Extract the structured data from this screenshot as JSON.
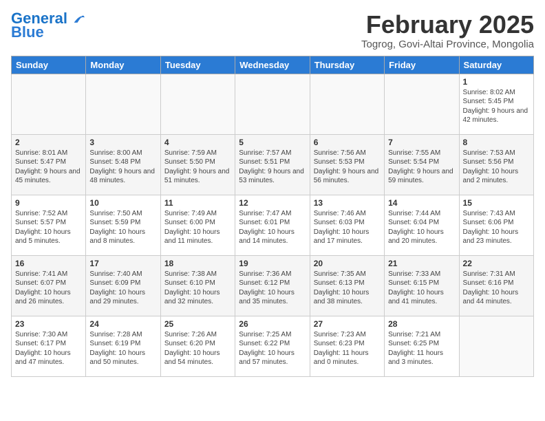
{
  "logo": {
    "line1": "General",
    "line2": "Blue"
  },
  "title": "February 2025",
  "location": "Togrog, Govi-Altai Province, Mongolia",
  "weekdays": [
    "Sunday",
    "Monday",
    "Tuesday",
    "Wednesday",
    "Thursday",
    "Friday",
    "Saturday"
  ],
  "weeks": [
    [
      {
        "day": "",
        "info": ""
      },
      {
        "day": "",
        "info": ""
      },
      {
        "day": "",
        "info": ""
      },
      {
        "day": "",
        "info": ""
      },
      {
        "day": "",
        "info": ""
      },
      {
        "day": "",
        "info": ""
      },
      {
        "day": "1",
        "info": "Sunrise: 8:02 AM\nSunset: 5:45 PM\nDaylight: 9 hours and 42 minutes."
      }
    ],
    [
      {
        "day": "2",
        "info": "Sunrise: 8:01 AM\nSunset: 5:47 PM\nDaylight: 9 hours and 45 minutes."
      },
      {
        "day": "3",
        "info": "Sunrise: 8:00 AM\nSunset: 5:48 PM\nDaylight: 9 hours and 48 minutes."
      },
      {
        "day": "4",
        "info": "Sunrise: 7:59 AM\nSunset: 5:50 PM\nDaylight: 9 hours and 51 minutes."
      },
      {
        "day": "5",
        "info": "Sunrise: 7:57 AM\nSunset: 5:51 PM\nDaylight: 9 hours and 53 minutes."
      },
      {
        "day": "6",
        "info": "Sunrise: 7:56 AM\nSunset: 5:53 PM\nDaylight: 9 hours and 56 minutes."
      },
      {
        "day": "7",
        "info": "Sunrise: 7:55 AM\nSunset: 5:54 PM\nDaylight: 9 hours and 59 minutes."
      },
      {
        "day": "8",
        "info": "Sunrise: 7:53 AM\nSunset: 5:56 PM\nDaylight: 10 hours and 2 minutes."
      }
    ],
    [
      {
        "day": "9",
        "info": "Sunrise: 7:52 AM\nSunset: 5:57 PM\nDaylight: 10 hours and 5 minutes."
      },
      {
        "day": "10",
        "info": "Sunrise: 7:50 AM\nSunset: 5:59 PM\nDaylight: 10 hours and 8 minutes."
      },
      {
        "day": "11",
        "info": "Sunrise: 7:49 AM\nSunset: 6:00 PM\nDaylight: 10 hours and 11 minutes."
      },
      {
        "day": "12",
        "info": "Sunrise: 7:47 AM\nSunset: 6:01 PM\nDaylight: 10 hours and 14 minutes."
      },
      {
        "day": "13",
        "info": "Sunrise: 7:46 AM\nSunset: 6:03 PM\nDaylight: 10 hours and 17 minutes."
      },
      {
        "day": "14",
        "info": "Sunrise: 7:44 AM\nSunset: 6:04 PM\nDaylight: 10 hours and 20 minutes."
      },
      {
        "day": "15",
        "info": "Sunrise: 7:43 AM\nSunset: 6:06 PM\nDaylight: 10 hours and 23 minutes."
      }
    ],
    [
      {
        "day": "16",
        "info": "Sunrise: 7:41 AM\nSunset: 6:07 PM\nDaylight: 10 hours and 26 minutes."
      },
      {
        "day": "17",
        "info": "Sunrise: 7:40 AM\nSunset: 6:09 PM\nDaylight: 10 hours and 29 minutes."
      },
      {
        "day": "18",
        "info": "Sunrise: 7:38 AM\nSunset: 6:10 PM\nDaylight: 10 hours and 32 minutes."
      },
      {
        "day": "19",
        "info": "Sunrise: 7:36 AM\nSunset: 6:12 PM\nDaylight: 10 hours and 35 minutes."
      },
      {
        "day": "20",
        "info": "Sunrise: 7:35 AM\nSunset: 6:13 PM\nDaylight: 10 hours and 38 minutes."
      },
      {
        "day": "21",
        "info": "Sunrise: 7:33 AM\nSunset: 6:15 PM\nDaylight: 10 hours and 41 minutes."
      },
      {
        "day": "22",
        "info": "Sunrise: 7:31 AM\nSunset: 6:16 PM\nDaylight: 10 hours and 44 minutes."
      }
    ],
    [
      {
        "day": "23",
        "info": "Sunrise: 7:30 AM\nSunset: 6:17 PM\nDaylight: 10 hours and 47 minutes."
      },
      {
        "day": "24",
        "info": "Sunrise: 7:28 AM\nSunset: 6:19 PM\nDaylight: 10 hours and 50 minutes."
      },
      {
        "day": "25",
        "info": "Sunrise: 7:26 AM\nSunset: 6:20 PM\nDaylight: 10 hours and 54 minutes."
      },
      {
        "day": "26",
        "info": "Sunrise: 7:25 AM\nSunset: 6:22 PM\nDaylight: 10 hours and 57 minutes."
      },
      {
        "day": "27",
        "info": "Sunrise: 7:23 AM\nSunset: 6:23 PM\nDaylight: 11 hours and 0 minutes."
      },
      {
        "day": "28",
        "info": "Sunrise: 7:21 AM\nSunset: 6:25 PM\nDaylight: 11 hours and 3 minutes."
      },
      {
        "day": "",
        "info": ""
      }
    ]
  ]
}
